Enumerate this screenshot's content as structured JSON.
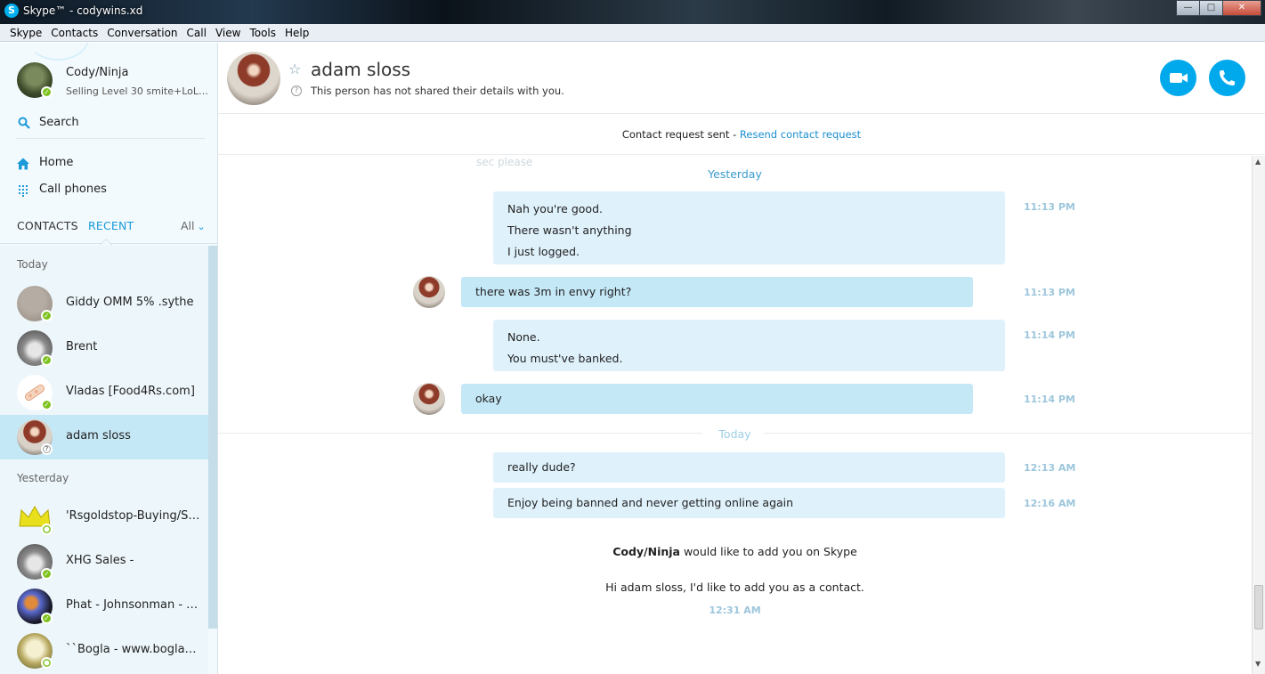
{
  "window": {
    "title": "Skype™ - codywins.xd",
    "buttons": {
      "minimize": "—",
      "maximize": "□",
      "close": "✕"
    }
  },
  "menu": [
    "Skype",
    "Contacts",
    "Conversation",
    "Call",
    "View",
    "Tools",
    "Help"
  ],
  "profile": {
    "name": "Cody/Ninja",
    "mood": "Selling Level 30 smite+LoL a...",
    "status": "online"
  },
  "sidebar": {
    "search_label": "Search",
    "home_label": "Home",
    "call_phones_label": "Call phones",
    "tab_contacts": "CONTACTS",
    "tab_recent": "RECENT",
    "filter_label": "All",
    "groups": {
      "today": "Today",
      "yesterday": "Yesterday"
    },
    "recent_today": [
      {
        "name": "Giddy OMM 5% .sythe",
        "status": "online"
      },
      {
        "name": "Brent",
        "status": "online"
      },
      {
        "name": "Vladas [Food4Rs.com]",
        "status": "online"
      },
      {
        "name": "adam sloss",
        "status": "unknown",
        "selected": true
      }
    ],
    "recent_yesterday": [
      {
        "name": "'Rsgoldstop-Buying/Sel...",
        "status": "offline"
      },
      {
        "name": "XHG Sales -",
        "status": "online"
      },
      {
        "name": "Phat - Johnsonman - M...",
        "status": "online"
      },
      {
        "name": "``Bogla - www.boglagol...",
        "status": "offline"
      }
    ]
  },
  "conversation": {
    "contact_name": "adam sloss",
    "contact_details": "This person has not shared their details with you.",
    "request_text": "Contact request sent - ",
    "request_link": "Resend contact request",
    "faded_text": "sec please",
    "day_yesterday": "Yesterday",
    "day_today": "Today",
    "messages": [
      {
        "from": "me",
        "lines": [
          "Nah you're good.",
          "There wasn't anything",
          "I just logged."
        ],
        "time": "11:13 PM"
      },
      {
        "from": "them",
        "lines": [
          "there was 3m in envy right?"
        ],
        "time": "11:13 PM"
      },
      {
        "from": "me",
        "lines": [
          "None.",
          "You must've banked."
        ],
        "time": "11:14 PM"
      },
      {
        "from": "them",
        "lines": [
          "okay"
        ],
        "time": "11:14 PM"
      },
      {
        "from": "me",
        "lines": [
          "really dude?"
        ],
        "time": "12:13 AM"
      },
      {
        "from": "me",
        "lines": [
          "Enjoy being banned and never getting online again"
        ],
        "time": "12:16 AM"
      }
    ],
    "add_request": {
      "sender": "Cody/Ninja",
      "text": " would like to add you on Skype",
      "message": "Hi adam sloss, I'd like to add you as a contact.",
      "time": "12:31 AM"
    }
  }
}
